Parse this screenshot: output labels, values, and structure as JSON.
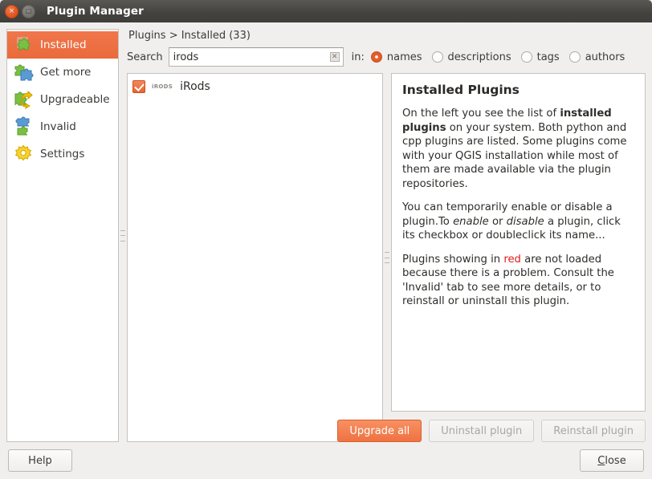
{
  "window": {
    "title": "Plugin Manager",
    "close_icon": "window-close-icon",
    "maximize_icon": "window-maximize-icon",
    "close_glyph": "×",
    "maximize_glyph": "□"
  },
  "sidebar": {
    "items": [
      {
        "label": "Installed",
        "icon": "puzzle-green-icon",
        "selected": true
      },
      {
        "label": "Get more",
        "icon": "puzzle-blue-icon",
        "selected": false
      },
      {
        "label": "Upgradeable",
        "icon": "puzzle-arrow-icon",
        "selected": false
      },
      {
        "label": "Invalid",
        "icon": "puzzle-broken-icon",
        "selected": false
      },
      {
        "label": "Settings",
        "icon": "gear-icon",
        "selected": false
      }
    ]
  },
  "content": {
    "breadcrumb": "Plugins > Installed (33)",
    "search": {
      "label": "Search",
      "value": "irods",
      "placeholder": "",
      "clear_icon": "clear-search-icon",
      "clear_glyph": "✕",
      "in_label": "in:",
      "options": [
        {
          "label": "names",
          "selected": true
        },
        {
          "label": "descriptions",
          "selected": false
        },
        {
          "label": "tags",
          "selected": false
        },
        {
          "label": "authors",
          "selected": false
        }
      ]
    },
    "plugin_list": [
      {
        "name": "iRods",
        "logo_text": "iRODS",
        "checked": true
      }
    ],
    "detail": {
      "title": "Installed Plugins",
      "paragraphs": [
        {
          "parts": [
            {
              "t": "On the left you see the list of ",
              "s": "n"
            },
            {
              "t": "installed plugins",
              "s": "b"
            },
            {
              "t": " on your system. Both python and cpp plugins are listed. Some plugins come with your QGIS installation while most of them are made available via the plugin repositories.",
              "s": "n"
            }
          ]
        },
        {
          "parts": [
            {
              "t": "You can temporarily enable or disable a plugin.To ",
              "s": "n"
            },
            {
              "t": "enable",
              "s": "i"
            },
            {
              "t": " or ",
              "s": "n"
            },
            {
              "t": "disable",
              "s": "i"
            },
            {
              "t": " a plugin, click its checkbox or doubleclick its name...",
              "s": "n"
            }
          ]
        },
        {
          "parts": [
            {
              "t": "Plugins showing in ",
              "s": "n"
            },
            {
              "t": "red",
              "s": "r"
            },
            {
              "t": " are not loaded because there is a problem. Consult the 'Invalid' tab to see more details, or to reinstall or uninstall this plugin.",
              "s": "n"
            }
          ]
        }
      ]
    },
    "actions": [
      {
        "label": "Upgrade all",
        "state": "primary"
      },
      {
        "label": "Uninstall plugin",
        "state": "disabled"
      },
      {
        "label": "Reinstall plugin",
        "state": "disabled"
      }
    ]
  },
  "footer": {
    "help_label": "Help",
    "close_label": "Close",
    "close_mnemonic": "C",
    "close_rest": "lose"
  },
  "colors": {
    "accent": "#ea6a3c",
    "titlebar": "#46443f",
    "window_bg": "#f0efee",
    "panel_bg": "#ffffff",
    "border": "#c6c2bd",
    "text": "#2f2e2b",
    "disabled_text": "#a9a6a1",
    "red": "#e01b1b"
  }
}
